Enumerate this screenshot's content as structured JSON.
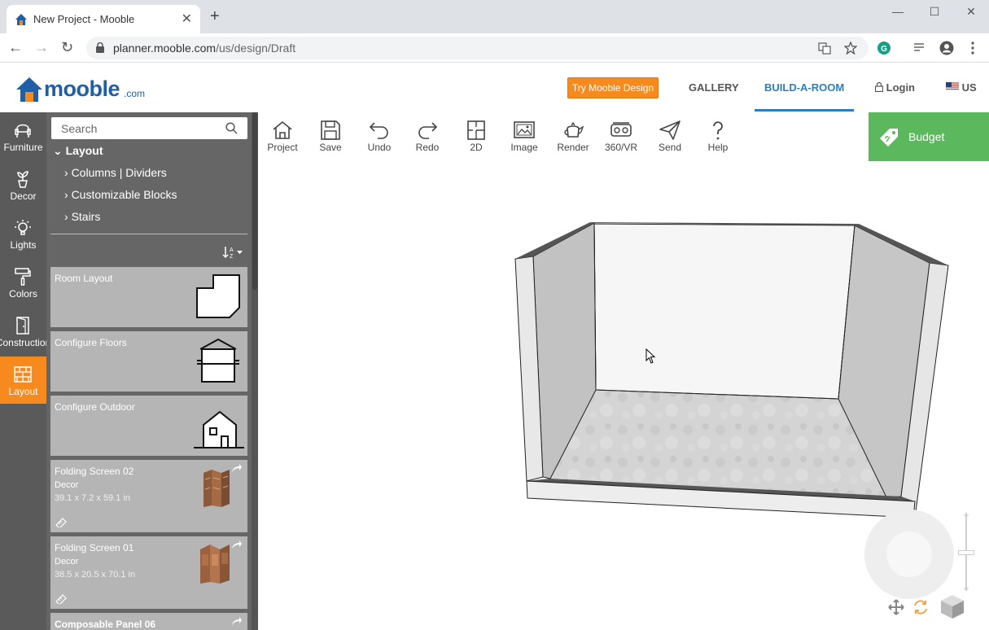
{
  "browser": {
    "tab_title": "New Project - Mooble",
    "tab_close": "✕",
    "new_tab": "+",
    "url_host": "planner.mooble.com",
    "url_path": "/us/design/Draft",
    "back": "←",
    "forward": "→",
    "reload": "↻",
    "minimize": "—",
    "maximize": "☐",
    "close": "✕"
  },
  "header": {
    "logo_text": "mooble",
    "logo_suffix": ".com",
    "try_button": "Try Mooble Design",
    "nav": [
      {
        "label": "GALLERY"
      },
      {
        "label": "BUILD-A-ROOM"
      }
    ],
    "login": "Login",
    "region": "US",
    "colors": {
      "accent": "#f68a1f",
      "brand": "#1f5fa8",
      "active": "#2a7fc1"
    }
  },
  "rail": [
    {
      "label": "Furniture",
      "icon": "chair-icon"
    },
    {
      "label": "Decor",
      "icon": "plant-icon"
    },
    {
      "label": "Lights",
      "icon": "bulb-icon"
    },
    {
      "label": "Colors",
      "icon": "paint-roller-icon"
    },
    {
      "label": "Construction",
      "icon": "door-icon"
    },
    {
      "label": "Layout",
      "icon": "brick-wall-icon",
      "active": true
    }
  ],
  "panel": {
    "search_placeholder": "Search",
    "tree_head": "Layout",
    "tree_items": [
      "Columns | Dividers",
      "Customizable Blocks",
      "Stairs"
    ],
    "cards": [
      {
        "title": "Room Layout"
      },
      {
        "title": "Configure Floors"
      },
      {
        "title": "Configure Outdoor"
      },
      {
        "title": "Folding Screen 02",
        "category": "Decor",
        "dims": "39.1 x 7.2 x 59.1 in"
      },
      {
        "title": "Folding Screen 01",
        "category": "Decor",
        "dims": "38.5 x 20.5 x 70.1 in"
      },
      {
        "title": "Composable Panel 06"
      }
    ]
  },
  "toolbar": {
    "tools": [
      {
        "label": "Project",
        "icon": "house-icon"
      },
      {
        "label": "Save",
        "icon": "floppy-icon"
      },
      {
        "label": "Undo",
        "icon": "undo-icon"
      },
      {
        "label": "Redo",
        "icon": "redo-icon"
      },
      {
        "label": "2D",
        "icon": "floorplan-icon"
      },
      {
        "label": "Image",
        "icon": "image-icon"
      },
      {
        "label": "Render",
        "icon": "teapot-icon"
      },
      {
        "label": "360/VR",
        "icon": "vr-headset-icon"
      },
      {
        "label": "Send",
        "icon": "paper-plane-icon"
      },
      {
        "label": "Help",
        "icon": "question-icon"
      }
    ],
    "budget": "Budget",
    "budget_color": "#5bb85d"
  },
  "viewport": {
    "zoom_plus": "+",
    "zoom_minus": "−"
  }
}
